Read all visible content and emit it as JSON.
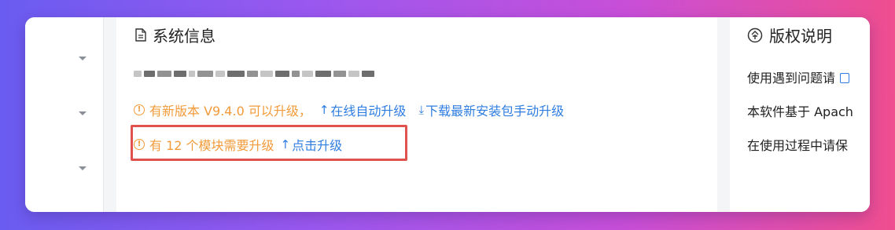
{
  "main_panel": {
    "title": "系统信息",
    "icon": "document-icon",
    "upgrade_notice": {
      "text": "有新版本 V9.4.0 可以升级，",
      "online_link": "在线自动升级",
      "download_link": "下载最新安装包手动升级"
    },
    "module_notice": {
      "text": "有 12 个模块需要升级",
      "link": "点击升级"
    }
  },
  "right_panel": {
    "title": "版权说明",
    "icon": "copyright-icon",
    "lines": [
      "使用遇到问题请",
      "本软件基于 Apach",
      "在使用过程中请保"
    ]
  },
  "colors": {
    "warning": "#f29b3a",
    "link": "#2f7de1",
    "highlight": "#e0524d"
  }
}
